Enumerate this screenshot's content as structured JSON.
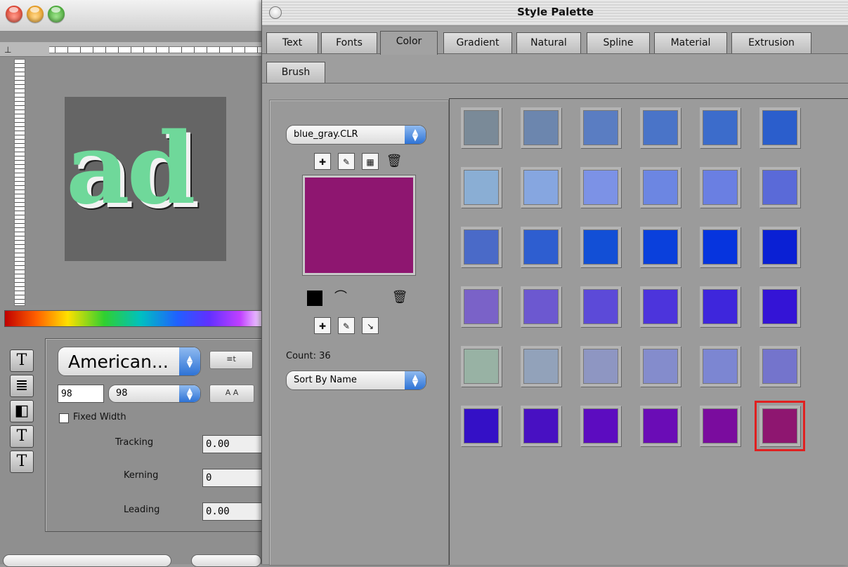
{
  "doc": {
    "preview_text": "ad",
    "font_name": "American...",
    "size_value": "98",
    "size_popup": "98",
    "fixed_width_label": "Fixed Width",
    "tracking_label": "Tracking",
    "tracking_value": "0.00",
    "kerning_label": "Kerning",
    "kerning_value": "0",
    "leading_label": "Leading",
    "leading_value": "0.00",
    "case_label": "A A",
    "tools": [
      "T",
      "≣",
      "◧",
      "T",
      "T"
    ]
  },
  "palette": {
    "title": "Style Palette",
    "tabs": [
      "Text",
      "Fonts",
      "Color",
      "Gradient",
      "Natural",
      "Spline",
      "Material",
      "Extrusion"
    ],
    "active_tab": "Color",
    "tab_row2": [
      "Brush"
    ],
    "swatch_file": "blue_gray.CLR",
    "count_label": "Count: 36",
    "sort_label": "Sort By Name",
    "current_color": "#8e1670",
    "selected_index": 35,
    "swatches": [
      "#7a8a98",
      "#6c86ae",
      "#5a7dc2",
      "#4a74c8",
      "#3c6ccb",
      "#2b5ecc",
      "#8aaed4",
      "#86a6e0",
      "#7c92e6",
      "#6c86e2",
      "#6a7fe2",
      "#5a6ad8",
      "#4a6ac8",
      "#2e5ed0",
      "#124fd6",
      "#0a40dc",
      "#0634de",
      "#0a20d4",
      "#7a62c8",
      "#6c58d0",
      "#5c4ad8",
      "#4c34dc",
      "#3e26dc",
      "#3414d6",
      "#98b2a4",
      "#92a2ba",
      "#8e96c2",
      "#848ccc",
      "#7c86d2",
      "#7474cc",
      "#3410c6",
      "#4810c2",
      "#5c0cc0",
      "#6a0cb6",
      "#7a0c9e",
      "#8e1670"
    ]
  }
}
